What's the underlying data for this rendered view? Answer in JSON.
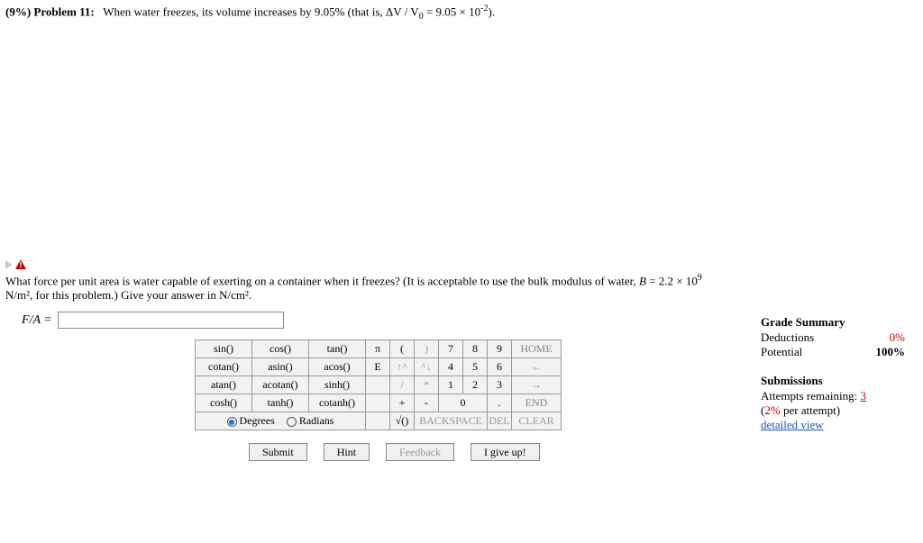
{
  "problem": {
    "weight": "(9%)",
    "label": "Problem 11:",
    "text_before": "When water freezes, its volume increases by 9.05% (that is, ΔV / V",
    "sub0": "0",
    "text_mid": " = 9.05 × 10",
    "sup": "-2",
    "text_after": ")."
  },
  "question": {
    "line1a": "What force per unit area is water capable of exerting on a container when it freezes? (It is acceptable to use the bulk modulus of water, ",
    "b_var": "B",
    "line1b": " = 2.2 × 10",
    "b_sup": "9",
    "line2": "N/m², for this problem.) Give your answer in N/cm²."
  },
  "answer": {
    "label": "F/A = ",
    "value": ""
  },
  "keypad": {
    "fns": [
      [
        "sin()",
        "cos()",
        "tan()"
      ],
      [
        "cotan()",
        "asin()",
        "acos()"
      ],
      [
        "atan()",
        "acotan()",
        "sinh()"
      ],
      [
        "cosh()",
        "tanh()",
        "cotanh()"
      ]
    ],
    "row1": [
      "π",
      "(",
      ")",
      "7",
      "8",
      "9"
    ],
    "row1_end": "HOME",
    "row2": [
      "E",
      "↑^",
      "^↓",
      "4",
      "5",
      "6"
    ],
    "row2_end": "←",
    "row3": [
      "",
      "/",
      "*",
      "1",
      "2",
      "3"
    ],
    "row3_end": "→",
    "row4": [
      "",
      "+",
      "-",
      "0",
      "",
      "."
    ],
    "row4_end": "END",
    "row5_a": "√()",
    "row5_b": "BACKSPACE",
    "row5_c": "DEL",
    "row5_d": "CLEAR",
    "degrees": "Degrees",
    "radians": "Radians"
  },
  "actions": {
    "submit": "Submit",
    "hint": "Hint",
    "feedback": "Feedback",
    "giveup": "I give up!"
  },
  "grade": {
    "title": "Grade Summary",
    "ded_label": "Deductions",
    "ded_val": "0%",
    "pot_label": "Potential",
    "pot_val": "100%",
    "sub_title": "Submissions",
    "att_label": "Attempts remaining: ",
    "att_val": "3",
    "per_label_a": "(",
    "per_val": "2%",
    "per_label_b": " per attempt)",
    "detailed": "detailed view"
  }
}
